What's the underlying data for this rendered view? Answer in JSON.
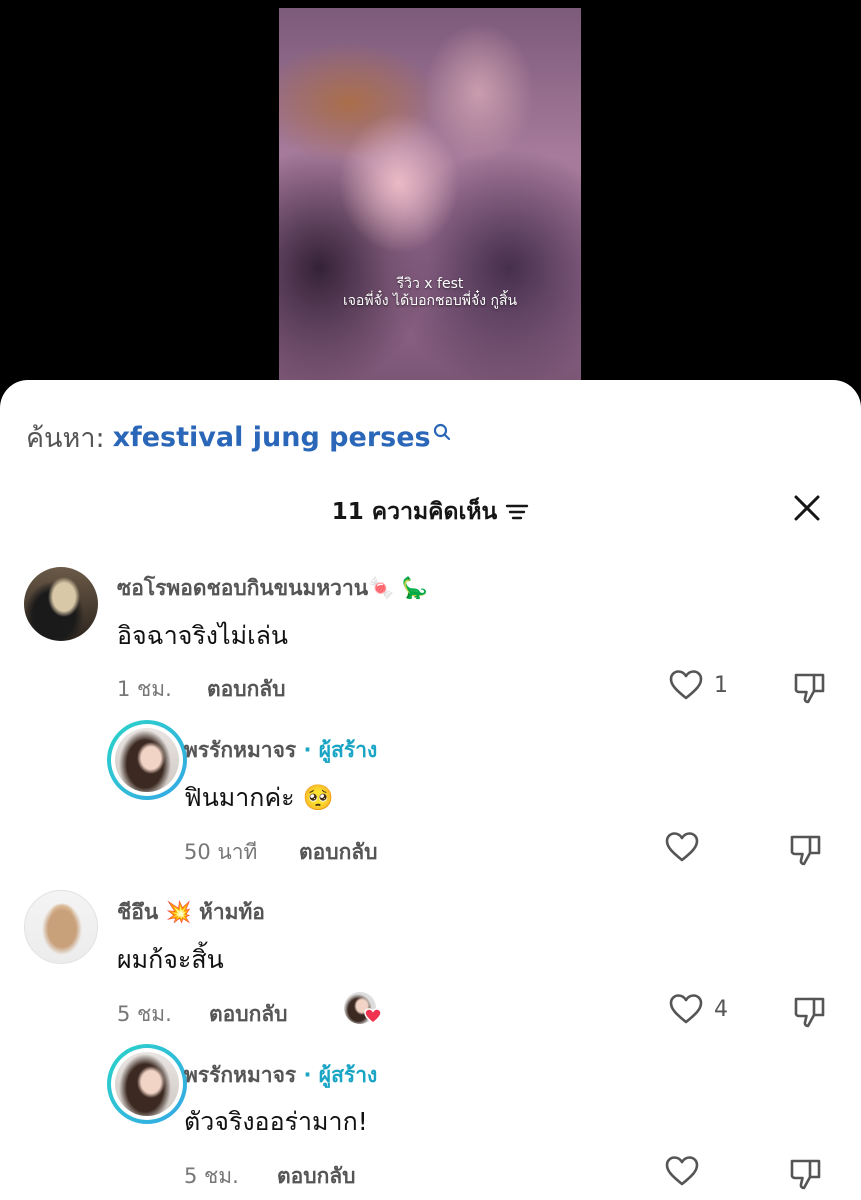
{
  "video": {
    "overlay_line1": "รีวิว x fest",
    "overlay_line2": "เจอพี่จั๋ง ได้บอกชอบพี่จั๋ง กูสิ้น"
  },
  "search": {
    "label": "ค้นหา:",
    "query": "xfestival jung perses",
    "icon": "search-icon"
  },
  "header": {
    "title": "11 ความคิดเห็น",
    "sort_icon": "sort-icon",
    "close_icon": "close-icon"
  },
  "comments": [
    {
      "name": "ซอโรพอดชอบกินขนมหวาน🍬 🦕",
      "text": "อิจฉาจริงไม่เล่น",
      "time": "1 ชม.",
      "reply": "ตอบกลับ",
      "likes": "1"
    },
    {
      "name": "พรรักหมาจร",
      "badge": "· ผู้สร้าง",
      "text": "ฟินมากค่ะ 🥺",
      "time": "50 นาที",
      "reply": "ตอบกลับ",
      "likes": ""
    },
    {
      "name": "ชีอึน 💥 ห้ามท้อ",
      "text": "ผมก้จะสิ้น",
      "time": "5 ชม.",
      "reply": "ตอบกลับ",
      "likes": "4"
    },
    {
      "name": "พรรักหมาจร",
      "badge": "· ผู้สร้าง",
      "text": "ตัวจริงออร่ามาก!",
      "time": "5 ชม.",
      "reply": "ตอบกลับ",
      "likes": ""
    }
  ],
  "colors": {
    "accent_blue": "#2b67b8",
    "creator_teal": "#1aa5c4",
    "heart_red": "#f0334f"
  }
}
